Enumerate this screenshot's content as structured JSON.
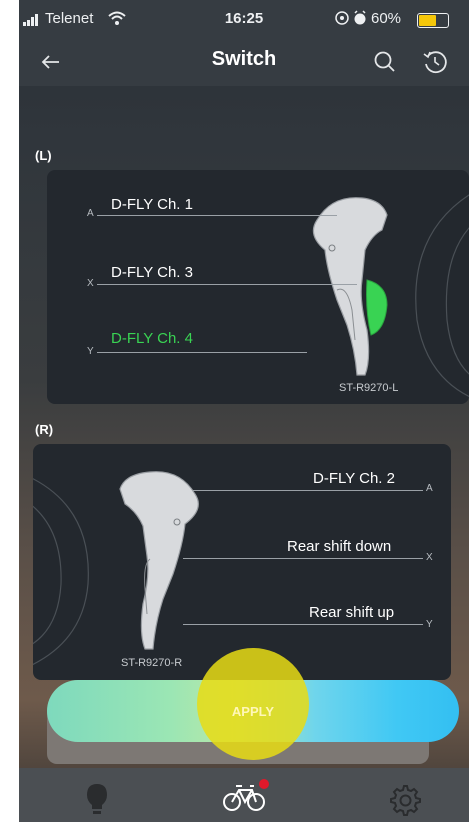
{
  "status_bar": {
    "carrier": "Telenet",
    "time": "16:25",
    "battery_percent": "60%"
  },
  "nav": {
    "title": "Switch",
    "back_icon": "arrow-left-icon",
    "search_icon": "search-icon",
    "history_icon": "history-icon"
  },
  "left": {
    "section_label": "(L)",
    "model": "ST-R9270-L",
    "buttons": [
      {
        "letter": "A",
        "label": "D-FLY Ch. 1",
        "color": "#ffffff"
      },
      {
        "letter": "X",
        "label": "D-FLY Ch. 3",
        "color": "#ffffff"
      },
      {
        "letter": "Y",
        "label": "D-FLY Ch. 4",
        "color": "#39d353"
      }
    ]
  },
  "right": {
    "section_label": "(R)",
    "model": "ST-R9270-R",
    "buttons": [
      {
        "letter": "A",
        "label": "D-FLY Ch. 2"
      },
      {
        "letter": "X",
        "label": "Rear shift down"
      },
      {
        "letter": "Y",
        "label": "Rear shift up"
      }
    ]
  },
  "apply": {
    "label": "APPLY"
  },
  "tab_bar": {
    "tabs": [
      {
        "icon": "lightbulb-icon"
      },
      {
        "icon": "bicycle-icon",
        "active": true,
        "badge_color": "#e0192b"
      },
      {
        "icon": "gear-icon"
      }
    ]
  },
  "colors": {
    "highlight_green": "#39d353",
    "accent_yellow": "#e8dc14"
  }
}
